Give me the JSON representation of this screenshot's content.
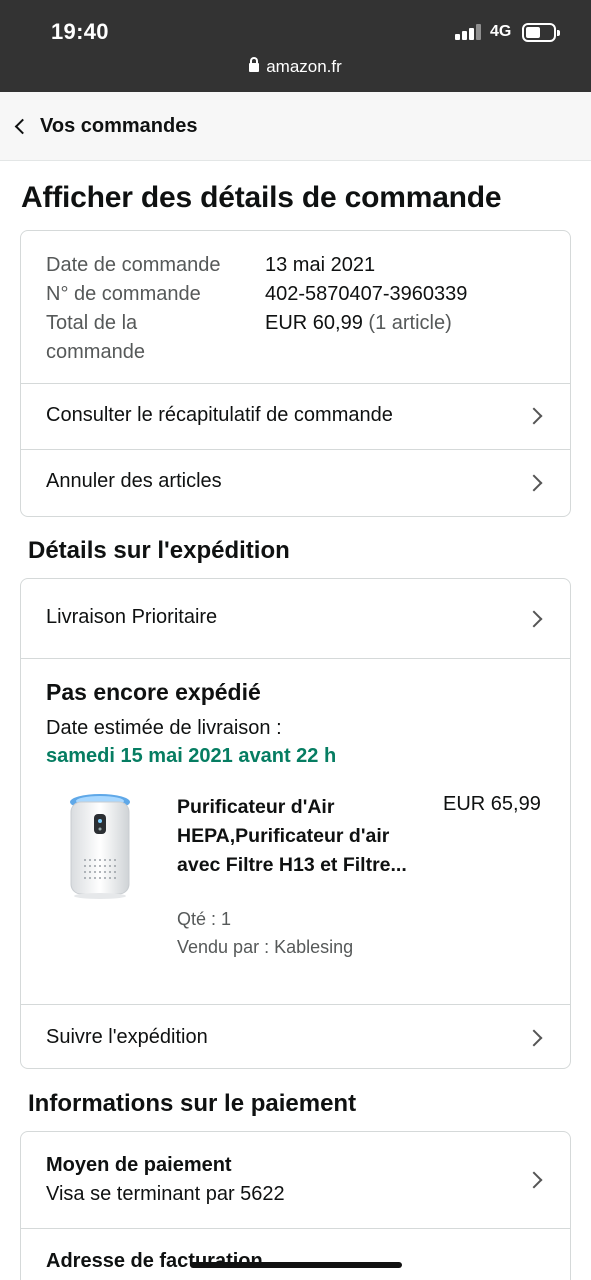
{
  "status_bar": {
    "time": "19:40",
    "network": "4G",
    "url": "amazon.fr",
    "battery_level": 0.55
  },
  "nav": {
    "back_label": "Vos commandes"
  },
  "page_title": "Afficher des détails de commande",
  "order_summary": {
    "date_label": "Date de commande",
    "date_value": "13 mai 2021",
    "number_label": "N° de commande",
    "number_value": "402-5870407-3960339",
    "total_label_line1": "Total de la",
    "total_label_line2": "commande",
    "total_value": "EUR 60,99",
    "total_count": "(1 article)",
    "links": {
      "recap": "Consulter le récapitulatif de commande",
      "cancel": "Annuler des articles"
    }
  },
  "shipping": {
    "heading": "Détails sur l'expédition",
    "method": "Livraison Prioritaire",
    "status": "Pas encore expédié",
    "estimate_label": "Date estimée de livraison :",
    "estimate_date": "samedi 15 mai 2021 avant 22 h",
    "item": {
      "title": "Purificateur d'Air HEPA,Purificateur d'air avec Filtre H13 et Filtre...",
      "price": "EUR 65,99",
      "quantity": "Qté : 1",
      "seller": "Vendu par : Kablesing"
    },
    "track_label": "Suivre l'expédition"
  },
  "payment": {
    "heading": "Informations sur le paiement",
    "method_title": "Moyen de paiement",
    "method_desc": "Visa se terminant par 5622",
    "billing_title": "Adresse de facturation"
  },
  "colors": {
    "status_bar_bg": "#333333",
    "delivery_green": "#067d62",
    "border": "#d5d9d9"
  }
}
